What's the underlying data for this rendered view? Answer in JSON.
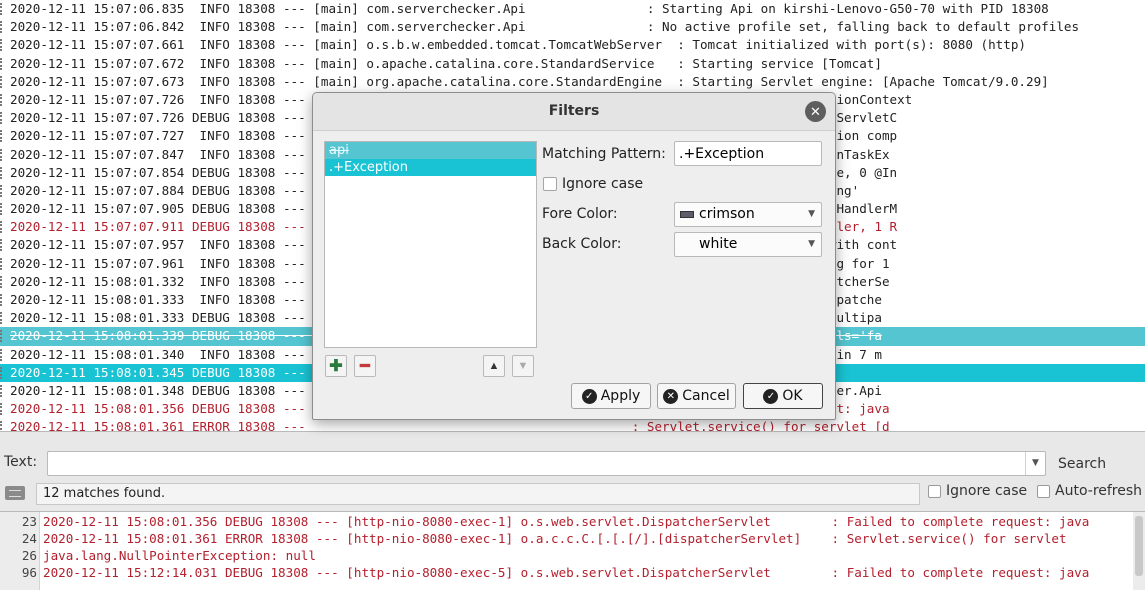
{
  "log_lines": [
    {
      "text": "2020-12-11 15:07:06.835  INFO 18308 --- [main] com.serverchecker.Api                : Starting Api on kirshi-Lenovo-G50-70 with PID 18308",
      "style": "normal"
    },
    {
      "text": "2020-12-11 15:07:06.842  INFO 18308 --- [main] com.serverchecker.Api                : No active profile set, falling back to default profiles",
      "style": "normal"
    },
    {
      "text": "2020-12-11 15:07:07.661  INFO 18308 --- [main] o.s.b.w.embedded.tomcat.TomcatWebServer  : Tomcat initialized with port(s): 8080 (http)",
      "style": "normal"
    },
    {
      "text": "2020-12-11 15:07:07.672  INFO 18308 --- [main] o.apache.catalina.core.StandardService   : Starting service [Tomcat]",
      "style": "normal"
    },
    {
      "text": "2020-12-11 15:07:07.673  INFO 18308 --- [main] org.apache.catalina.core.StandardEngine  : Starting Servlet engine: [Apache Tomcat/9.0.29]",
      "style": "normal"
    },
    {
      "text": "2020-12-11 15:07:07.726  INFO 18308 ---                                           Spring embedded WebApplicationContext",
      "style": "normal"
    },
    {
      "text": "2020-12-11 15:07:07.726 DEBUG 18308 ---                                           t WebApplicationContext as ServletC",
      "style": "normal"
    },
    {
      "text": "2020-12-11 15:07:07.727  INFO 18308 ---                                           icationContext: initialization comp",
      "style": "normal"
    },
    {
      "text": "2020-12-11 15:07:07.847  INFO 18308 ---                                           ExecutorService 'applicationTaskEx",
      "style": "normal"
    },
    {
      "text": "2020-12-11 15:07:07.854 DEBUG 18308 ---                                           ice beans: 0 @ModelAttribute, 0 @In",
      "style": "normal"
    },
    {
      "text": "2020-12-11 15:07:07.884 DEBUG 18308 ---                                           'requestMappingHandlerMapping'",
      "style": "normal"
    },
    {
      "text": "2020-12-11 15:07:07.905 DEBUG 18308 ---                                           bjars/**, /**] in 'resourceHandlerM",
      "style": "normal"
    },
    {
      "text": "2020-12-11 15:07:07.911 DEBUG 18308 ---                                           ice beans: 0 @ExceptionHandler, 1 R",
      "style": "err"
    },
    {
      "text": "2020-12-11 15:07:07.957  INFO 18308 ---                                           d on port(s): 8080 (http) with cont",
      "style": "normal"
    },
    {
      "text": "2020-12-11 15:07:07.961  INFO 18308 ---                                           n 1.517 seconds (JVM running for 1",
      "style": "normal"
    },
    {
      "text": "2020-12-11 15:08:01.332  INFO 18308 ---                                           : Initializing Spring DispatcherSe",
      "style": "normal"
    },
    {
      "text": "2020-12-11 15:08:01.333  INFO 18308 ---                                           : Initializing Servlet 'dispatche",
      "style": "normal"
    },
    {
      "text": "2020-12-11 15:08:01.333 DEBUG 18308 ---                                           : Detected StandardServletMultipa",
      "style": "normal"
    },
    {
      "text": "2020-12-11 15:08:01.339 DEBUG 18308 ---                                           : enableLoggingRequestDetails='fa",
      "style": "hl"
    },
    {
      "text": "2020-12-11 15:08:01.340  INFO 18308 ---                                           : Completed initialization in 7 m",
      "style": "normal"
    },
    {
      "text": "2020-12-11 15:08:01.345 DEBUG 18308 ---                                           : GET \"/api\", parameters={}",
      "style": "hl2"
    },
    {
      "text": "2020-12-11 15:08:01.348 DEBUG 18308 ---                                           : Mapped to com.serverchecker.Api",
      "style": "normal"
    },
    {
      "text": "2020-12-11 15:08:01.356 DEBUG 18308 ---                                           : Failed to complete request: java",
      "style": "err"
    },
    {
      "text": "2020-12-11 15:08:01.361 ERROR 18308 ---                                           : Servlet.service() for servlet [d",
      "style": "err"
    }
  ],
  "search": {
    "label": "Text:",
    "value": "",
    "button_label": "Search"
  },
  "status": {
    "message": "12 matches found.",
    "ignore_case_label": "Ignore case",
    "auto_refresh_label": "Auto-refresh"
  },
  "results": [
    {
      "line": "23",
      "text": "2020-12-11 15:08:01.356 DEBUG 18308 --- [http-nio-8080-exec-1] o.s.web.servlet.DispatcherServlet        : Failed to complete request: java"
    },
    {
      "line": "24",
      "text": "2020-12-11 15:08:01.361 ERROR 18308 --- [http-nio-8080-exec-1] o.a.c.c.C.[.[.[/].[dispatcherServlet]    : Servlet.service() for servlet"
    },
    {
      "line": "26",
      "text": "java.lang.NullPointerException: null"
    },
    {
      "line": "96",
      "text": "2020-12-11 15:12:14.031 DEBUG 18308 --- [http-nio-8080-exec-5] o.s.web.servlet.DispatcherServlet        : Failed to complete request: java"
    }
  ],
  "dialog": {
    "title": "Filters",
    "filters": [
      {
        "label": "api",
        "struck": true
      },
      {
        "label": ".+Exception",
        "struck": false
      }
    ],
    "matching_pattern_label": "Matching Pattern:",
    "matching_pattern_value": ".+Exception",
    "ignore_case_label": "Ignore case",
    "fore_color_label": "Fore Color:",
    "fore_color_value": "crimson",
    "back_color_label": "Back Color:",
    "back_color_value": "white",
    "apply_label": "Apply",
    "cancel_label": "Cancel",
    "ok_label": "OK"
  },
  "colors": {
    "highlight": "#1ac3d3",
    "error_text": "#b3202e"
  }
}
